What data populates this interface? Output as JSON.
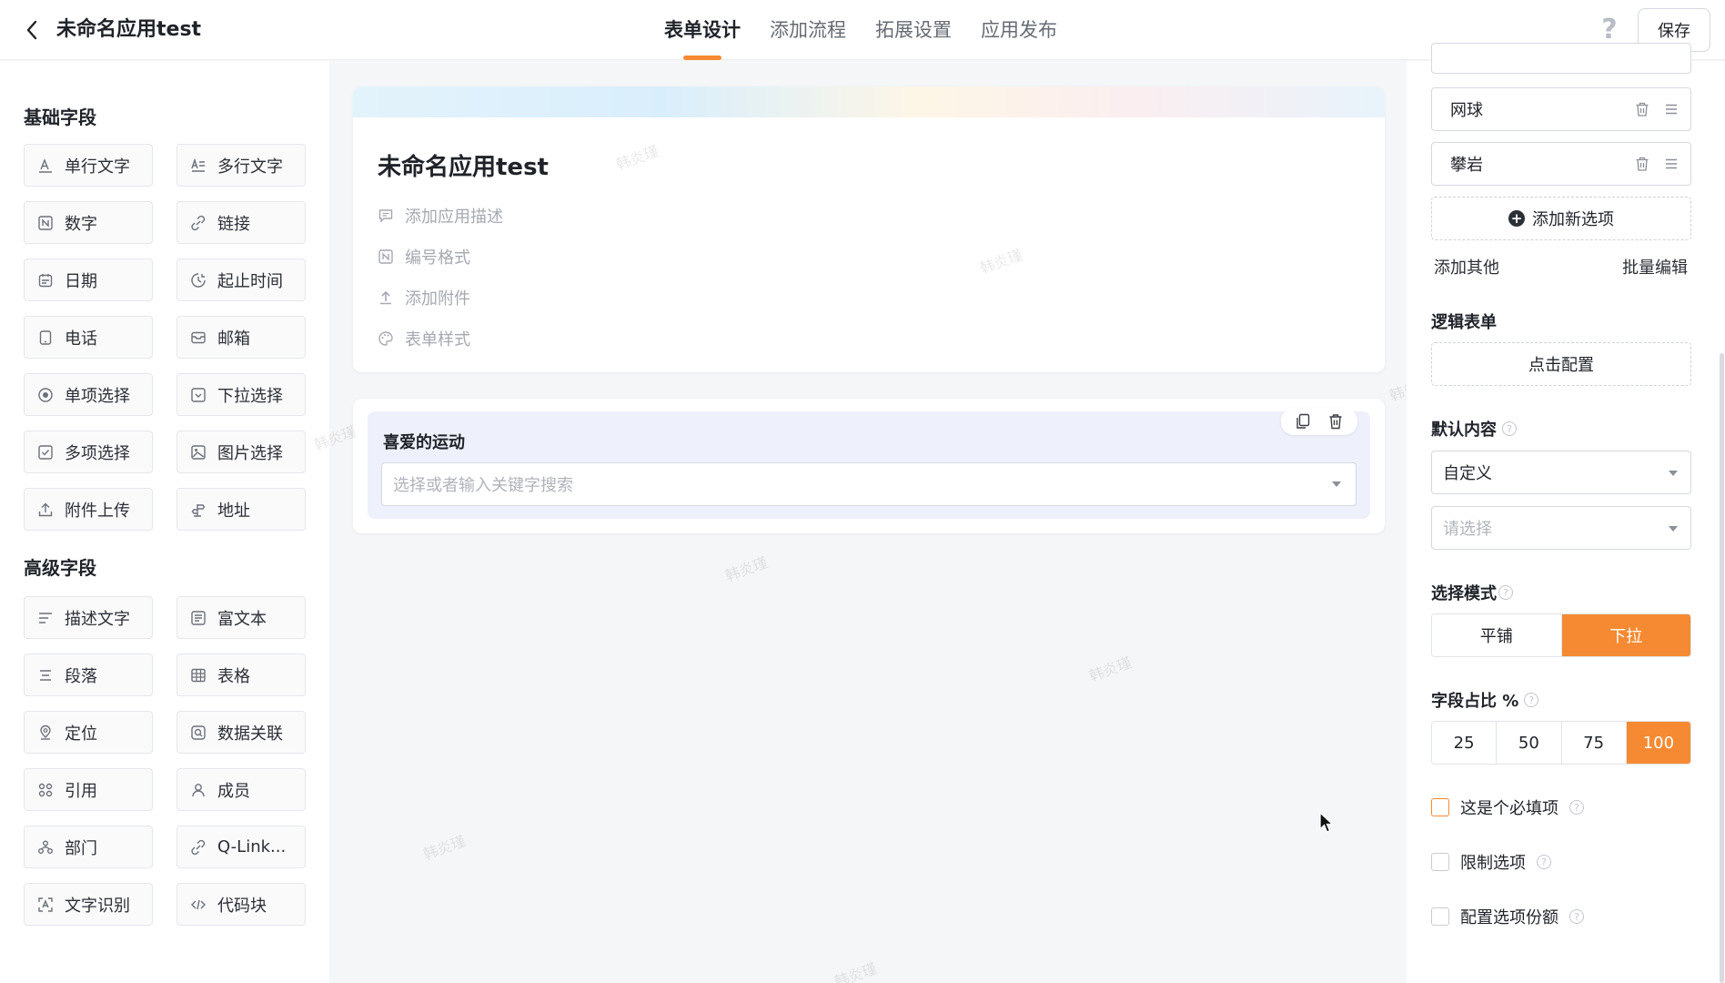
{
  "header": {
    "app_title": "未命名应用test",
    "tabs": [
      {
        "label": "表单设计",
        "active": true
      },
      {
        "label": "添加流程",
        "active": false
      },
      {
        "label": "拓展设置",
        "active": false
      },
      {
        "label": "应用发布",
        "active": false
      }
    ],
    "help_symbol": "?",
    "save_label": "保存"
  },
  "left": {
    "basic_title": "基础字段",
    "basic_fields": [
      {
        "label": "单行文字",
        "icon": "text-a-icon"
      },
      {
        "label": "多行文字",
        "icon": "multiline-text-icon"
      },
      {
        "label": "数字",
        "icon": "number-icon"
      },
      {
        "label": "链接",
        "icon": "link-icon"
      },
      {
        "label": "日期",
        "icon": "calendar-icon"
      },
      {
        "label": "起止时间",
        "icon": "time-range-icon"
      },
      {
        "label": "电话",
        "icon": "phone-icon"
      },
      {
        "label": "邮箱",
        "icon": "mail-icon"
      },
      {
        "label": "单项选择",
        "icon": "radio-icon"
      },
      {
        "label": "下拉选择",
        "icon": "dropdown-icon"
      },
      {
        "label": "多项选择",
        "icon": "checkbox-icon"
      },
      {
        "label": "图片选择",
        "icon": "image-icon"
      },
      {
        "label": "附件上传",
        "icon": "upload-icon"
      },
      {
        "label": "地址",
        "icon": "location-sign-icon"
      }
    ],
    "advanced_title": "高级字段",
    "advanced_fields": [
      {
        "label": "描述文字",
        "icon": "description-icon"
      },
      {
        "label": "富文本",
        "icon": "rich-text-icon"
      },
      {
        "label": "段落",
        "icon": "paragraph-icon"
      },
      {
        "label": "表格",
        "icon": "table-icon"
      },
      {
        "label": "定位",
        "icon": "pin-icon"
      },
      {
        "label": "数据关联",
        "icon": "data-link-icon"
      },
      {
        "label": "引用",
        "icon": "reference-icon"
      },
      {
        "label": "成员",
        "icon": "member-icon"
      },
      {
        "label": "部门",
        "icon": "department-icon"
      },
      {
        "label": "Q-Link...",
        "icon": "qlink-icon"
      },
      {
        "label": "文字识别",
        "icon": "ocr-icon"
      },
      {
        "label": "代码块",
        "icon": "code-icon"
      }
    ]
  },
  "canvas": {
    "form_title": "未命名应用test",
    "meta_items": [
      {
        "label": "添加应用描述",
        "icon": "comment-icon"
      },
      {
        "label": "编号格式",
        "icon": "number-format-icon"
      },
      {
        "label": "添加附件",
        "icon": "upload-icon"
      },
      {
        "label": "表单样式",
        "icon": "palette-icon"
      }
    ],
    "field": {
      "label": "喜爱的运动",
      "placeholder": "选择或者输入关键字搜索"
    },
    "watermark": "韩炎瑾"
  },
  "right": {
    "options": [
      "网球",
      "攀岩"
    ],
    "add_option_label": "添加新选项",
    "add_other_label": "添加其他",
    "batch_edit_label": "批量编辑",
    "logic_form_title": "逻辑表单",
    "logic_config_label": "点击配置",
    "default_title": "默认内容",
    "default_mode_value": "自定义",
    "default_value_placeholder": "请选择",
    "select_mode_title": "选择模式",
    "select_modes": [
      {
        "label": "平铺",
        "active": false
      },
      {
        "label": "下拉",
        "active": true
      }
    ],
    "width_title": "字段占比 %",
    "width_options": [
      {
        "label": "25",
        "active": false
      },
      {
        "label": "50",
        "active": false
      },
      {
        "label": "75",
        "active": false
      },
      {
        "label": "100",
        "active": true
      }
    ],
    "checks": [
      {
        "label": "这是个必填项",
        "checked": false
      },
      {
        "label": "限制选项",
        "checked": false
      },
      {
        "label": "配置选项份额",
        "checked": false
      }
    ]
  },
  "colors": {
    "accent": "#f58a32",
    "selected_field_bg": "#eef0fb"
  }
}
